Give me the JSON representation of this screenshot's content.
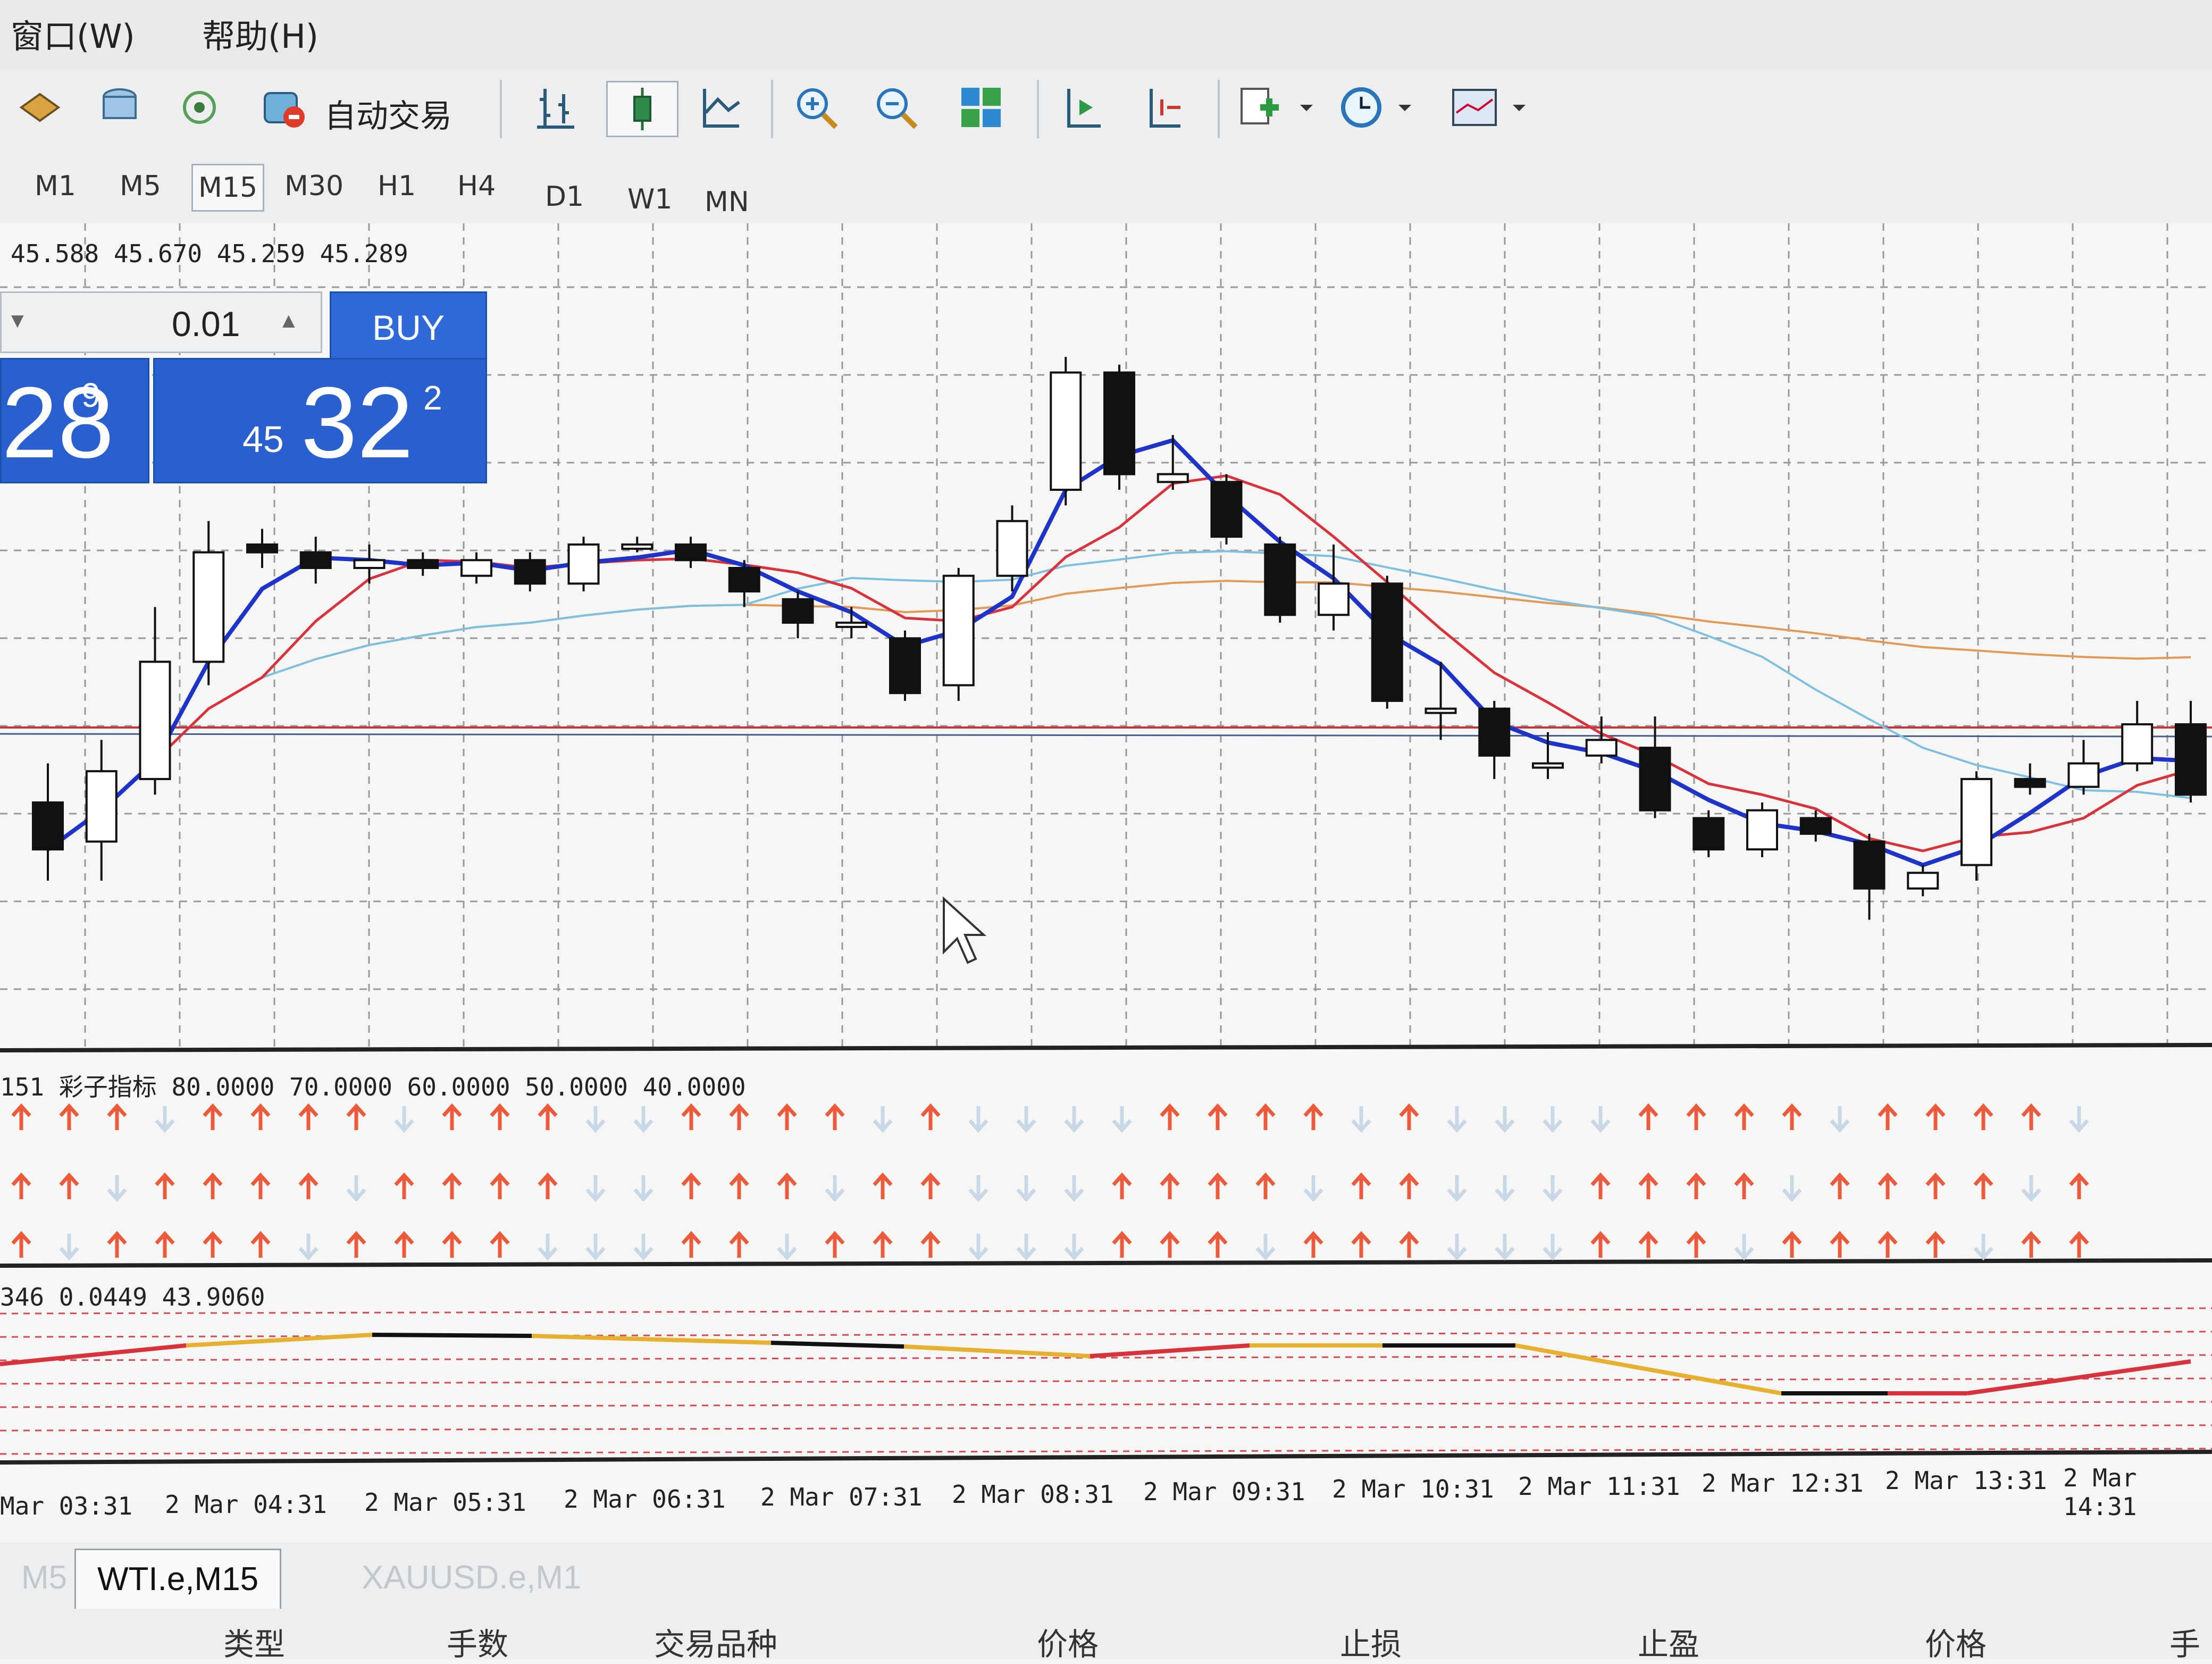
{
  "menu": {
    "window": "窗口(W)",
    "help": "帮助(H)"
  },
  "toolbar": {
    "auto_trade": "自动交易"
  },
  "timeframes": [
    "M1",
    "M5",
    "M15",
    "M30",
    "H1",
    "H4",
    "D1",
    "W1",
    "MN"
  ],
  "active_timeframe": "M15",
  "chart": {
    "ohlc": "45.588 45.670 45.259 45.289",
    "lot": "0.01",
    "buy_label": "BUY",
    "sell_price_big": "28",
    "sell_price_sup": "9",
    "buy_price_prefix": "45",
    "buy_price_big": "32",
    "buy_price_sup": "2",
    "indicator1_label": "151 彩子指标   80.0000 70.0000 60.0000 50.0000 40.0000",
    "indicator2_label": "346 0.0449 43.9060",
    "time_labels": [
      "Mar 03:31",
      "2 Mar 04:31",
      "2 Mar 05:31",
      "2 Mar 06:31",
      "2 Mar 07:31",
      "2 Mar 08:31",
      "2 Mar 09:31",
      "2 Mar 10:31",
      "2 Mar 11:31",
      "2 Mar 12:31",
      "2 Mar 13:31",
      "2 Mar 14:31"
    ]
  },
  "chart_data": {
    "type": "candlestick",
    "symbol": "WTI.e",
    "timeframe": "M15",
    "candles_relative": [
      {
        "o": 0.3,
        "c": 0.24,
        "h": 0.35,
        "l": 0.2
      },
      {
        "o": 0.25,
        "c": 0.34,
        "h": 0.38,
        "l": 0.2
      },
      {
        "o": 0.33,
        "c": 0.48,
        "h": 0.55,
        "l": 0.31
      },
      {
        "o": 0.48,
        "c": 0.62,
        "h": 0.66,
        "l": 0.45
      },
      {
        "o": 0.63,
        "c": 0.62,
        "h": 0.65,
        "l": 0.6
      },
      {
        "o": 0.62,
        "c": 0.6,
        "h": 0.64,
        "l": 0.58
      },
      {
        "o": 0.6,
        "c": 0.61,
        "h": 0.63,
        "l": 0.58
      },
      {
        "o": 0.61,
        "c": 0.6,
        "h": 0.62,
        "l": 0.59
      },
      {
        "o": 0.59,
        "c": 0.61,
        "h": 0.62,
        "l": 0.58
      },
      {
        "o": 0.61,
        "c": 0.58,
        "h": 0.62,
        "l": 0.57
      },
      {
        "o": 0.58,
        "c": 0.63,
        "h": 0.64,
        "l": 0.57
      },
      {
        "o": 0.63,
        "c": 0.63,
        "h": 0.64,
        "l": 0.62
      },
      {
        "o": 0.63,
        "c": 0.61,
        "h": 0.64,
        "l": 0.6
      },
      {
        "o": 0.6,
        "c": 0.57,
        "h": 0.61,
        "l": 0.55
      },
      {
        "o": 0.56,
        "c": 0.53,
        "h": 0.57,
        "l": 0.51
      },
      {
        "o": 0.53,
        "c": 0.53,
        "h": 0.55,
        "l": 0.51
      },
      {
        "o": 0.51,
        "c": 0.44,
        "h": 0.52,
        "l": 0.43
      },
      {
        "o": 0.45,
        "c": 0.59,
        "h": 0.6,
        "l": 0.43
      },
      {
        "o": 0.59,
        "c": 0.66,
        "h": 0.68,
        "l": 0.57
      },
      {
        "o": 0.7,
        "c": 0.85,
        "h": 0.87,
        "l": 0.68
      },
      {
        "o": 0.85,
        "c": 0.72,
        "h": 0.86,
        "l": 0.7
      },
      {
        "o": 0.71,
        "c": 0.72,
        "h": 0.77,
        "l": 0.7
      },
      {
        "o": 0.71,
        "c": 0.64,
        "h": 0.72,
        "l": 0.63
      },
      {
        "o": 0.63,
        "c": 0.54,
        "h": 0.64,
        "l": 0.53
      },
      {
        "o": 0.54,
        "c": 0.58,
        "h": 0.63,
        "l": 0.52
      },
      {
        "o": 0.58,
        "c": 0.43,
        "h": 0.59,
        "l": 0.42
      },
      {
        "o": 0.42,
        "c": 0.42,
        "h": 0.48,
        "l": 0.38
      },
      {
        "o": 0.42,
        "c": 0.36,
        "h": 0.43,
        "l": 0.33
      },
      {
        "o": 0.35,
        "c": 0.35,
        "h": 0.39,
        "l": 0.33
      },
      {
        "o": 0.36,
        "c": 0.38,
        "h": 0.41,
        "l": 0.35
      },
      {
        "o": 0.37,
        "c": 0.29,
        "h": 0.41,
        "l": 0.28
      },
      {
        "o": 0.28,
        "c": 0.24,
        "h": 0.29,
        "l": 0.23
      },
      {
        "o": 0.24,
        "c": 0.29,
        "h": 0.3,
        "l": 0.23
      },
      {
        "o": 0.28,
        "c": 0.26,
        "h": 0.29,
        "l": 0.25
      },
      {
        "o": 0.25,
        "c": 0.19,
        "h": 0.26,
        "l": 0.15
      },
      {
        "o": 0.19,
        "c": 0.21,
        "h": 0.22,
        "l": 0.18
      },
      {
        "o": 0.22,
        "c": 0.33,
        "h": 0.34,
        "l": 0.2
      },
      {
        "o": 0.33,
        "c": 0.32,
        "h": 0.35,
        "l": 0.31
      },
      {
        "o": 0.32,
        "c": 0.35,
        "h": 0.38,
        "l": 0.31
      },
      {
        "o": 0.35,
        "c": 0.4,
        "h": 0.43,
        "l": 0.34
      },
      {
        "o": 0.4,
        "c": 0.31,
        "h": 0.43,
        "l": 0.3
      }
    ]
  },
  "tabs": [
    "M5",
    "WTI.e,M15",
    "XAUUSD.e,M1"
  ],
  "active_tab": "WTI.e,M15",
  "columns": [
    "类型",
    "手数",
    "交易品种",
    "价格",
    "止损",
    "止盈",
    "价格",
    "手"
  ]
}
